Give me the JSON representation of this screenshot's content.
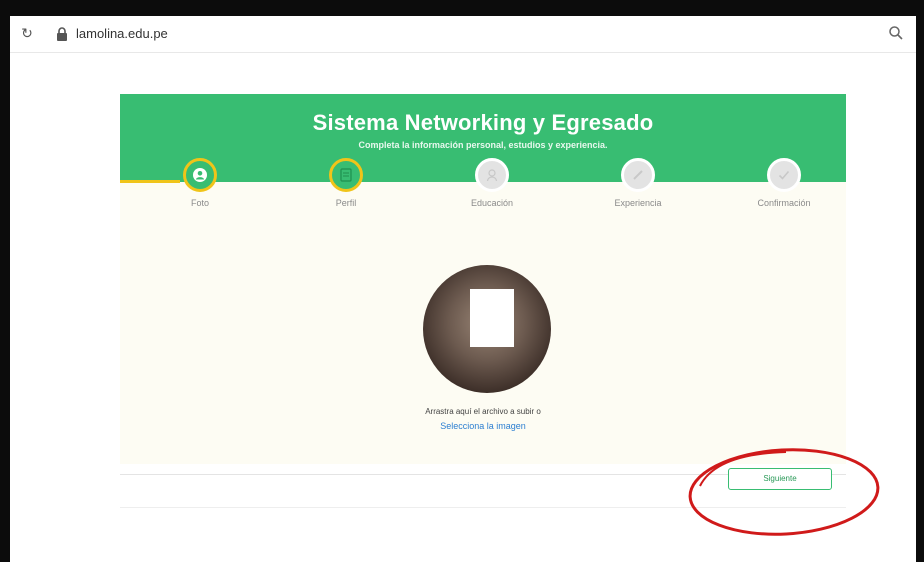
{
  "browser": {
    "url": "lamolina.edu.pe",
    "icons": {
      "reload": "reload-icon",
      "lock": "lock-icon",
      "zoom": "zoom-icon"
    }
  },
  "header": {
    "title": "Sistema Networking y Egresado",
    "subtitle": "Completa la información personal, estudios y experiencia."
  },
  "steps": [
    {
      "label": "Foto",
      "icon": "user-circle-icon",
      "state": "done"
    },
    {
      "label": "Perfil",
      "icon": "profile-icon",
      "state": "done"
    },
    {
      "label": "Educación",
      "icon": "graduation-icon",
      "state": "todo"
    },
    {
      "label": "Experiencia",
      "icon": "pencil-icon",
      "state": "todo"
    },
    {
      "label": "Confirmación",
      "icon": "check-icon",
      "state": "todo"
    }
  ],
  "upload": {
    "drop_text": "Arrastra aquí el archivo a subir o",
    "select_link": "Selecciona la imagen"
  },
  "actions": {
    "next_label": "Siguiente"
  },
  "colors": {
    "brand_green": "#38bd72",
    "accent_yellow": "#f0c419",
    "annotation_red": "#d01a1a"
  }
}
